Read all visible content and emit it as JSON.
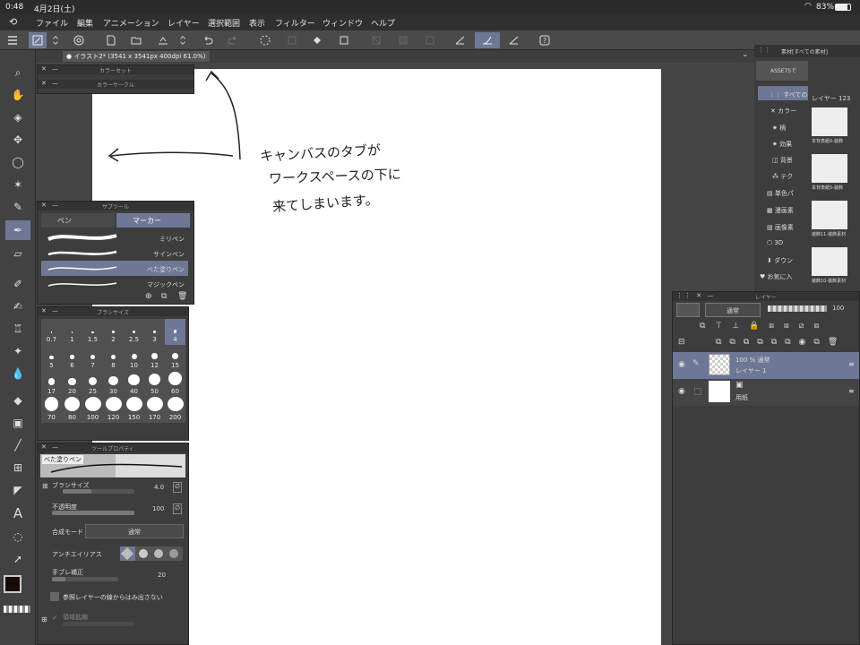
{
  "status": {
    "time": "0:48",
    "date": "4月2日(土)",
    "battery": "83%"
  },
  "menu": [
    "ファイル",
    "編集",
    "アニメーション",
    "レイヤー",
    "選択範囲",
    "表示",
    "フィルター",
    "ウィンドウ",
    "ヘルプ"
  ],
  "canvas_tab": "● イラスト2* (3541 x 3541px 400dpi 61.0%)",
  "panels": {
    "color_set": "カラーセット",
    "color_circle": "カラーサークル",
    "sub_tool": "サブツール",
    "brush_size": "ブラシサイズ",
    "tool_property": "ツールプロパティ",
    "layer": "レイヤー",
    "material": "素材[すべての素材]"
  },
  "subtool": {
    "tabs": [
      "ペン",
      "マーカー"
    ],
    "items": [
      "ミリペン",
      "サインペン",
      "べた塗りペン",
      "マジックペン"
    ]
  },
  "brush_sizes": [
    "0.7",
    "1",
    "1.5",
    "2",
    "2.5",
    "3",
    "4",
    "5",
    "6",
    "7",
    "8",
    "10",
    "12",
    "15",
    "17",
    "20",
    "25",
    "30",
    "40",
    "50",
    "60",
    "70",
    "80",
    "100",
    "120",
    "150",
    "170",
    "200"
  ],
  "tool_property": {
    "brush_name": "べた塗りペン",
    "brush_size_label": "ブラシサイズ",
    "brush_size_value": "4.0",
    "opacity_label": "不透明度",
    "opacity_value": "100",
    "blend_label": "合成モード",
    "blend_value": "通常",
    "antialias_label": "アンチエイリアス",
    "stabilize_label": "手ブレ補正",
    "stabilize_value": "20",
    "ref_label": "参照レイヤーの線からはみ出さない",
    "area_label": "領域拡縮"
  },
  "layer_panel": {
    "blend": "通常",
    "opacity": "100",
    "layers": [
      {
        "info": "100 % 通常",
        "name": "レイヤー 1"
      },
      {
        "info": "",
        "name": "用紙"
      }
    ]
  },
  "material_panel": {
    "assets": "ASSETSで",
    "tree": [
      "すべての",
      "カラー",
      "柄",
      "効果",
      "背景",
      "テク",
      "単色パ",
      "漫画素",
      "画像素",
      "3D",
      "ダウン",
      "お気に入"
    ],
    "layer_label": "レイヤー 123",
    "thumbs": [
      "本背表紙6-装飾",
      "本背表紙5-装飾",
      "装飾11-装飾素材",
      "装飾10-装飾素材"
    ]
  },
  "annotation": {
    "line1": "キャンバスのタブが",
    "line2": "ワークスペースの下に",
    "line3": "来てしまいます。"
  },
  "colors": {
    "accent": "#6e7796",
    "bg": "#3a3a3a",
    "canvas": "#ffffff"
  }
}
